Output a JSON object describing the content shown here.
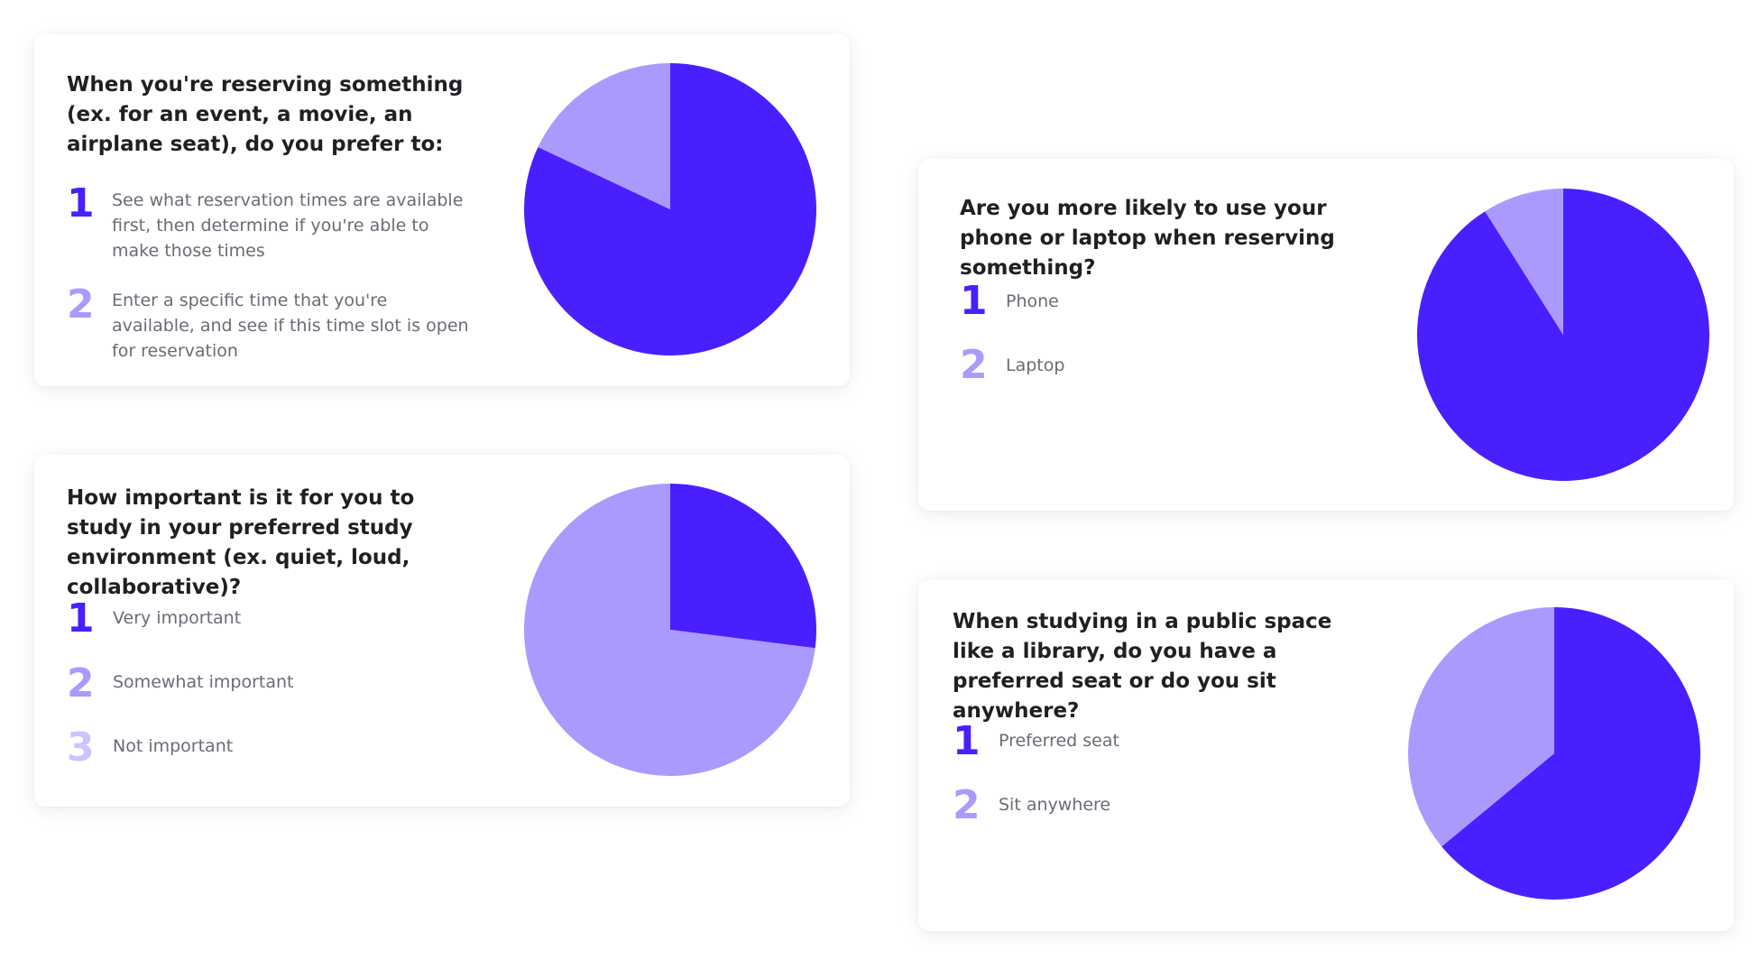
{
  "colors": {
    "primary": "#4a1fff",
    "secondary": "#ab9afe",
    "tertiary": "#cdc3ff"
  },
  "cards": [
    {
      "question": "When you're reserving something (ex. for an event, a movie, an airplane seat), do you prefer to:",
      "options": [
        {
          "number": "1",
          "text": "See what reservation times are available first, then determine if you're able to make those times"
        },
        {
          "number": "2",
          "text": "Enter a specific time that you're available, and see if this time slot is open for reservation"
        }
      ]
    },
    {
      "question": "How important is it for you to study in your preferred study environment (ex. quiet, loud, collaborative)?",
      "options": [
        {
          "number": "1",
          "text": "Very important"
        },
        {
          "number": "2",
          "text": "Somewhat important"
        },
        {
          "number": "3",
          "text": "Not important"
        }
      ]
    },
    {
      "question": "Are you more likely to use your phone or laptop when reserving something?",
      "options": [
        {
          "number": "1",
          "text": "Phone"
        },
        {
          "number": "2",
          "text": "Laptop"
        }
      ]
    },
    {
      "question": "When studying in a public space like a library, do you have a preferred seat or do you sit anywhere?",
      "options": [
        {
          "number": "1",
          "text": "Preferred seat"
        },
        {
          "number": "2",
          "text": "Sit anywhere"
        }
      ]
    }
  ],
  "chart_data": [
    {
      "type": "pie",
      "title": "",
      "slices": [
        {
          "label": "1",
          "value": 82,
          "color": "#4a1fff"
        },
        {
          "label": "2",
          "value": 18,
          "color": "#ab9afe"
        }
      ]
    },
    {
      "type": "pie",
      "title": "",
      "slices": [
        {
          "label": "1",
          "value": 27,
          "color": "#4a1fff"
        },
        {
          "label": "2",
          "value": 73,
          "color": "#ab9afe"
        },
        {
          "label": "3",
          "value": 0,
          "color": "#cdc3ff"
        }
      ]
    },
    {
      "type": "pie",
      "title": "",
      "slices": [
        {
          "label": "1",
          "value": 91,
          "color": "#4a1fff"
        },
        {
          "label": "2",
          "value": 9,
          "color": "#ab9afe"
        }
      ]
    },
    {
      "type": "pie",
      "title": "",
      "slices": [
        {
          "label": "1",
          "value": 64,
          "color": "#4a1fff"
        },
        {
          "label": "2",
          "value": 36,
          "color": "#ab9afe"
        }
      ]
    }
  ]
}
